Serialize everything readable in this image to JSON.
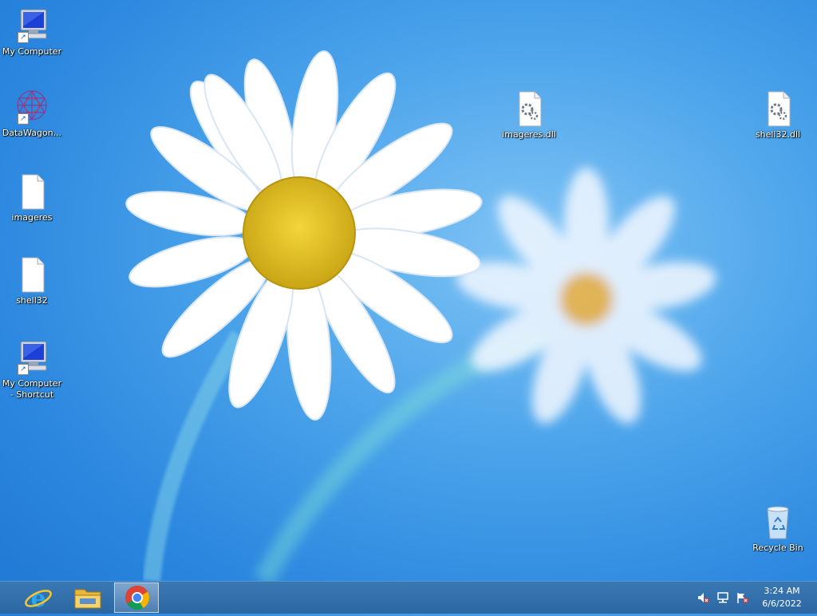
{
  "desktop": {
    "icons": [
      {
        "label": "My Computer",
        "icon": "computer-icon"
      },
      {
        "label": "DataWagon...",
        "icon": "datawagon-icon"
      },
      {
        "label": "imageres",
        "icon": "file-icon"
      },
      {
        "label": "shell32",
        "icon": "file-icon"
      },
      {
        "label": "My Computer - Shortcut",
        "icon": "computer-icon"
      },
      {
        "label": "imageres.dll",
        "icon": "dll-file-icon"
      },
      {
        "label": "shell32.dll",
        "icon": "dll-file-icon"
      },
      {
        "label": "Recycle Bin",
        "icon": "recycle-bin-icon"
      }
    ]
  },
  "taskbar": {
    "apps": [
      {
        "name": "Internet Explorer",
        "icon": "internet-explorer-icon"
      },
      {
        "name": "File Explorer",
        "icon": "file-explorer-icon"
      },
      {
        "name": "Google Chrome",
        "icon": "chrome-icon",
        "active": true
      }
    ],
    "tray": {
      "icons": [
        "speaker-muted-icon",
        "network-icon",
        "action-center-flag-icon"
      ],
      "time": "3:24 AM",
      "date": "6/6/2022"
    }
  }
}
